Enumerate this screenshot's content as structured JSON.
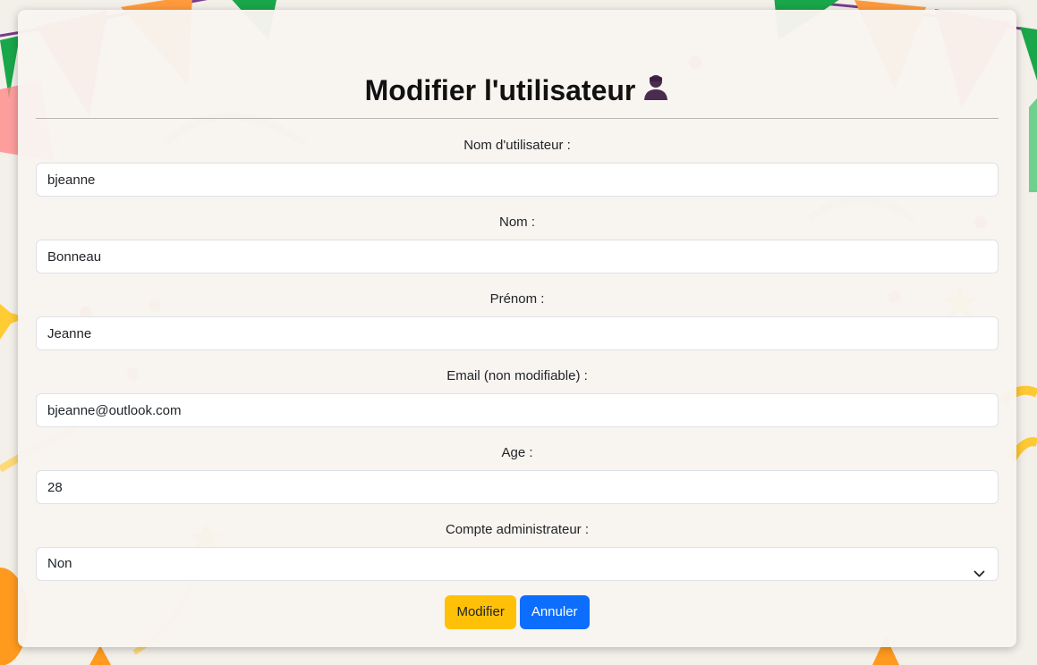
{
  "page": {
    "title": "Modifier l'utilisateur",
    "title_icon": "user-icon"
  },
  "form": {
    "username": {
      "label": "Nom d'utilisateur :",
      "value": "bjeanne"
    },
    "lastname": {
      "label": "Nom :",
      "value": "Bonneau"
    },
    "firstname": {
      "label": "Prénom :",
      "value": "Jeanne"
    },
    "email": {
      "label": "Email (non modifiable) :",
      "value": "bjeanne@outlook.com"
    },
    "age": {
      "label": "Age :",
      "value": "28"
    },
    "admin": {
      "label": "Compte administrateur :",
      "selected": "Non"
    }
  },
  "buttons": {
    "modify_label": "Modifier",
    "cancel_label": "Annuler"
  },
  "colors": {
    "modify_button": "#ffc107",
    "cancel_button": "#0d6efd",
    "card_background": "#f8f4f0"
  }
}
